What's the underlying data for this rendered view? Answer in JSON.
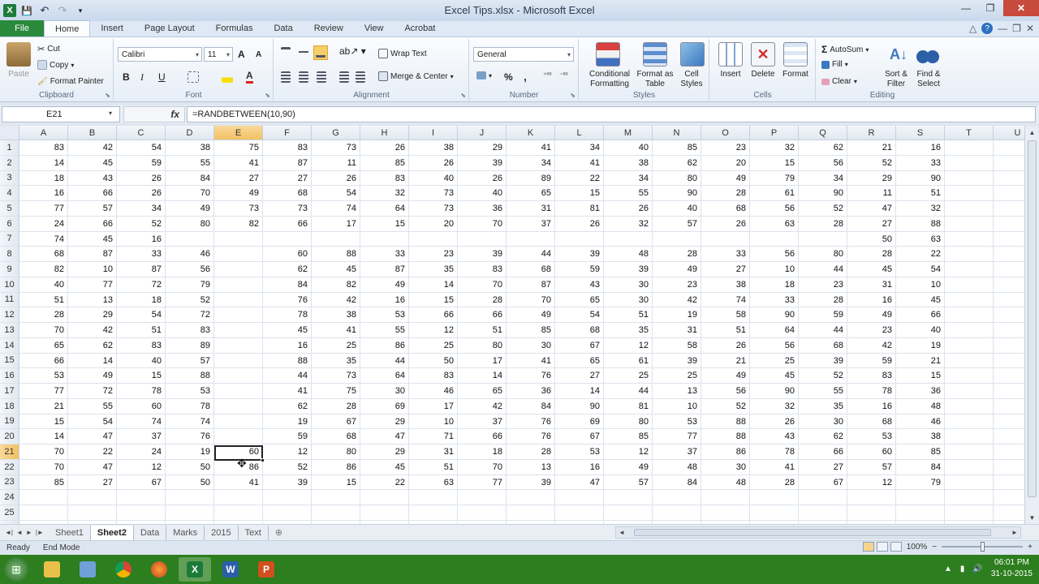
{
  "window": {
    "title": "Excel Tips.xlsx - Microsoft Excel",
    "app_letter": "X"
  },
  "quick_access": {
    "save": "💾",
    "undo": "↶",
    "redo": "↷",
    "customize": "▾"
  },
  "window_controls": {
    "minimize": "—",
    "maximize": "❐",
    "close": "✕"
  },
  "ribbon_tabs": [
    "Home",
    "Insert",
    "Page Layout",
    "Formulas",
    "Data",
    "Review",
    "View",
    "Acrobat"
  ],
  "file_tab": "File",
  "help_icons": [
    "△",
    "?",
    "—",
    "❐",
    "✕"
  ],
  "clipboard": {
    "paste": "Paste",
    "cut": "Cut",
    "copy": "Copy",
    "format_painter": "Format Painter",
    "label": "Clipboard"
  },
  "font": {
    "name": "Calibri",
    "size": "11",
    "grow": "A",
    "shrink": "A",
    "bold": "B",
    "italic": "I",
    "underline": "U",
    "label": "Font"
  },
  "alignment": {
    "wrap_text": "Wrap Text",
    "merge_center": "Merge & Center",
    "label": "Alignment"
  },
  "number": {
    "format": "General",
    "percent": "%",
    "comma": "‚",
    "label": "Number"
  },
  "styles": {
    "conditional": "Conditional Formatting",
    "format_table": "Format as Table",
    "cell_styles": "Cell Styles",
    "label": "Styles"
  },
  "cells": {
    "insert": "Insert",
    "delete": "Delete",
    "format": "Format",
    "label": "Cells"
  },
  "editing": {
    "autosum": "AutoSum",
    "fill": "Fill",
    "clear": "Clear",
    "sort_filter": "Sort & Filter",
    "find_select": "Find & Select",
    "label": "Editing"
  },
  "formula_bar": {
    "name_box": "E21",
    "fx": "fx",
    "formula": "=RANDBETWEEN(10,90)"
  },
  "columns": [
    "A",
    "B",
    "C",
    "D",
    "E",
    "F",
    "G",
    "H",
    "I",
    "J",
    "K",
    "L",
    "M",
    "N",
    "O",
    "P",
    "Q",
    "R",
    "S",
    "T",
    "U"
  ],
  "selected_column": "E",
  "selected_row": 21,
  "rows": [
    {
      "n": 1,
      "v": [
        "83",
        "42",
        "54",
        "38",
        "75",
        "83",
        "73",
        "26",
        "38",
        "29",
        "41",
        "34",
        "40",
        "85",
        "23",
        "32",
        "62",
        "21",
        "16",
        "",
        ""
      ]
    },
    {
      "n": 2,
      "v": [
        "14",
        "45",
        "59",
        "55",
        "41",
        "87",
        "11",
        "85",
        "26",
        "39",
        "34",
        "41",
        "38",
        "62",
        "20",
        "15",
        "56",
        "52",
        "33",
        "",
        ""
      ]
    },
    {
      "n": 3,
      "v": [
        "18",
        "43",
        "26",
        "84",
        "27",
        "27",
        "26",
        "83",
        "40",
        "26",
        "89",
        "22",
        "34",
        "80",
        "49",
        "79",
        "34",
        "29",
        "90",
        "",
        ""
      ]
    },
    {
      "n": 4,
      "v": [
        "16",
        "66",
        "26",
        "70",
        "49",
        "68",
        "54",
        "32",
        "73",
        "40",
        "65",
        "15",
        "55",
        "90",
        "28",
        "61",
        "90",
        "11",
        "51",
        "",
        ""
      ]
    },
    {
      "n": 5,
      "v": [
        "77",
        "57",
        "34",
        "49",
        "73",
        "73",
        "74",
        "64",
        "73",
        "36",
        "31",
        "81",
        "26",
        "40",
        "68",
        "56",
        "52",
        "47",
        "32",
        "",
        ""
      ]
    },
    {
      "n": 6,
      "v": [
        "24",
        "66",
        "52",
        "80",
        "82",
        "66",
        "17",
        "15",
        "20",
        "70",
        "37",
        "26",
        "32",
        "57",
        "26",
        "63",
        "28",
        "27",
        "88",
        "",
        ""
      ]
    },
    {
      "n": 7,
      "v": [
        "74",
        "45",
        "16",
        "",
        "",
        "",
        "",
        "",
        "",
        "",
        "",
        "",
        "",
        "",
        "",
        "",
        "",
        "50",
        "63",
        "",
        ""
      ]
    },
    {
      "n": 8,
      "v": [
        "68",
        "87",
        "33",
        "46",
        "",
        "60",
        "88",
        "33",
        "23",
        "39",
        "44",
        "39",
        "48",
        "28",
        "33",
        "56",
        "80",
        "28",
        "22",
        "",
        ""
      ]
    },
    {
      "n": 9,
      "v": [
        "82",
        "10",
        "87",
        "56",
        "",
        "62",
        "45",
        "87",
        "35",
        "83",
        "68",
        "59",
        "39",
        "49",
        "27",
        "10",
        "44",
        "45",
        "54",
        "",
        ""
      ]
    },
    {
      "n": 10,
      "v": [
        "40",
        "77",
        "72",
        "79",
        "",
        "84",
        "82",
        "49",
        "14",
        "70",
        "87",
        "43",
        "30",
        "23",
        "38",
        "18",
        "23",
        "31",
        "10",
        "",
        ""
      ]
    },
    {
      "n": 11,
      "v": [
        "51",
        "13",
        "18",
        "52",
        "",
        "76",
        "42",
        "16",
        "15",
        "28",
        "70",
        "65",
        "30",
        "42",
        "74",
        "33",
        "28",
        "16",
        "45",
        "",
        ""
      ]
    },
    {
      "n": 12,
      "v": [
        "28",
        "29",
        "54",
        "72",
        "",
        "78",
        "38",
        "53",
        "66",
        "66",
        "49",
        "54",
        "51",
        "19",
        "58",
        "90",
        "59",
        "49",
        "66",
        "",
        ""
      ]
    },
    {
      "n": 13,
      "v": [
        "70",
        "42",
        "51",
        "83",
        "",
        "45",
        "41",
        "55",
        "12",
        "51",
        "85",
        "68",
        "35",
        "31",
        "51",
        "64",
        "44",
        "23",
        "40",
        "",
        ""
      ]
    },
    {
      "n": 14,
      "v": [
        "65",
        "62",
        "83",
        "89",
        "",
        "16",
        "25",
        "86",
        "25",
        "80",
        "30",
        "67",
        "12",
        "58",
        "26",
        "56",
        "68",
        "42",
        "19",
        "",
        ""
      ]
    },
    {
      "n": 15,
      "v": [
        "66",
        "14",
        "40",
        "57",
        "",
        "88",
        "35",
        "44",
        "50",
        "17",
        "41",
        "65",
        "61",
        "39",
        "21",
        "25",
        "39",
        "59",
        "21",
        "",
        ""
      ]
    },
    {
      "n": 16,
      "v": [
        "53",
        "49",
        "15",
        "88",
        "",
        "44",
        "73",
        "64",
        "83",
        "14",
        "76",
        "27",
        "25",
        "25",
        "49",
        "45",
        "52",
        "83",
        "15",
        "",
        ""
      ]
    },
    {
      "n": 17,
      "v": [
        "77",
        "72",
        "78",
        "53",
        "",
        "41",
        "75",
        "30",
        "46",
        "65",
        "36",
        "14",
        "44",
        "13",
        "56",
        "90",
        "55",
        "78",
        "36",
        "",
        ""
      ]
    },
    {
      "n": 18,
      "v": [
        "21",
        "55",
        "60",
        "78",
        "",
        "62",
        "28",
        "69",
        "17",
        "42",
        "84",
        "90",
        "81",
        "10",
        "52",
        "32",
        "35",
        "16",
        "48",
        "",
        ""
      ]
    },
    {
      "n": 19,
      "v": [
        "15",
        "54",
        "74",
        "74",
        "",
        "19",
        "67",
        "29",
        "10",
        "37",
        "76",
        "69",
        "80",
        "53",
        "88",
        "26",
        "30",
        "68",
        "46",
        "",
        ""
      ]
    },
    {
      "n": 20,
      "v": [
        "14",
        "47",
        "37",
        "76",
        "",
        "59",
        "68",
        "47",
        "71",
        "66",
        "76",
        "67",
        "85",
        "77",
        "88",
        "43",
        "62",
        "53",
        "38",
        "",
        ""
      ]
    },
    {
      "n": 21,
      "v": [
        "70",
        "22",
        "24",
        "19",
        "60",
        "12",
        "80",
        "29",
        "31",
        "18",
        "28",
        "53",
        "12",
        "37",
        "86",
        "78",
        "66",
        "60",
        "85",
        "",
        ""
      ]
    },
    {
      "n": 22,
      "v": [
        "70",
        "47",
        "12",
        "50",
        "86",
        "52",
        "86",
        "45",
        "51",
        "70",
        "13",
        "16",
        "49",
        "48",
        "30",
        "41",
        "27",
        "57",
        "84",
        "",
        ""
      ]
    },
    {
      "n": 23,
      "v": [
        "85",
        "27",
        "67",
        "50",
        "41",
        "39",
        "15",
        "22",
        "63",
        "77",
        "39",
        "47",
        "57",
        "84",
        "48",
        "28",
        "67",
        "12",
        "79",
        "",
        ""
      ]
    },
    {
      "n": 24,
      "v": [
        "",
        "",
        "",
        "",
        "",
        "",
        "",
        "",
        "",
        "",
        "",
        "",
        "",
        "",
        "",
        "",
        "",
        "",
        "",
        "",
        ""
      ]
    },
    {
      "n": 25,
      "v": [
        "",
        "",
        "",
        "",
        "",
        "",
        "",
        "",
        "",
        "",
        "",
        "",
        "",
        "",
        "",
        "",
        "",
        "",
        "",
        "",
        ""
      ]
    },
    {
      "n": 26,
      "v": [
        "",
        "",
        "",
        "",
        "",
        "",
        "",
        "",
        "",
        "",
        "",
        "",
        "",
        "",
        "",
        "",
        "",
        "",
        "",
        "",
        ""
      ]
    }
  ],
  "sheet_tabs": [
    {
      "name": "Sheet1",
      "active": false
    },
    {
      "name": "Sheet2",
      "active": true
    },
    {
      "name": "Data",
      "active": false
    },
    {
      "name": "Marks",
      "active": false
    },
    {
      "name": "2015",
      "active": false
    },
    {
      "name": "Text",
      "active": false
    }
  ],
  "status": {
    "ready": "Ready",
    "end_mode": "End Mode",
    "zoom": "100%",
    "minus": "−",
    "plus": "+"
  },
  "taskbar": {
    "start": "⊞",
    "time": "06:01 PM",
    "date": "31-10-2015",
    "apps": [
      "explorer-icon",
      "media-icon",
      "chrome-icon",
      "firefox-icon",
      "excel-icon",
      "word-icon",
      "powerpoint-icon"
    ]
  },
  "colors": {
    "excel_green": "#2a8a3c",
    "selection_orange": "#f2c162",
    "taskbar": "#2c7e1e"
  }
}
